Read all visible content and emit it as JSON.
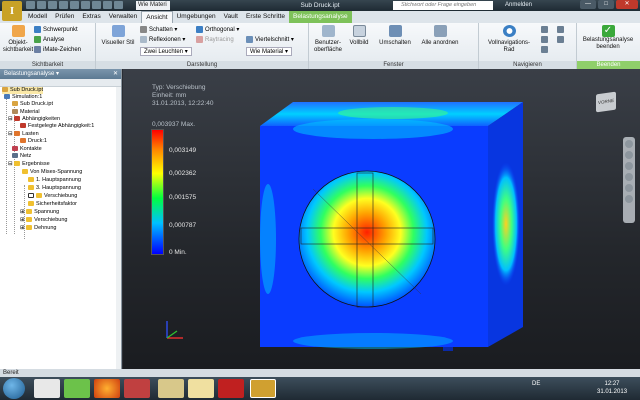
{
  "app": {
    "title": "Sub Druck.ipt",
    "qat_material": "Wie Materi",
    "search_placeholder": "Stichwort oder Frage eingeben",
    "login": "Anmelden",
    "window_controls": [
      "—",
      "□",
      "✕"
    ]
  },
  "tabs": [
    "Modell",
    "Prüfen",
    "Extras",
    "Verwalten",
    "Ansicht",
    "Umgebungen",
    "Vault",
    "Erste Schritte",
    "Belastungsanalyse"
  ],
  "active_tab": "Ansicht",
  "ribbon": {
    "sichtbarkeit": {
      "label": "Sichtbarkeit",
      "objekt": "Objekt-\nsichtbarkeit",
      "schwerpunkt": "Schwerpunkt",
      "analyse": "Analyse",
      "imate": "iMate-Zeichen"
    },
    "darstellung": {
      "label": "Darstellung",
      "visueller_stil": "Visueller Stil",
      "schatten": "Schatten",
      "reflexionen": "Reflexionen",
      "zwei_leuchten": "Zwei Leuchten",
      "orthogonal": "Orthogonal",
      "raytracing": "Raytracing",
      "viertelschnitt": "Viertelschnitt",
      "wie_material": "Wie Material"
    },
    "fenster": {
      "label": "Fenster",
      "benutzer": "Benutzer-\noberfläche",
      "vollbild": "Vollbild",
      "umschalten": "Umschalten",
      "alle_anordnen": "Alle anordnen"
    },
    "navigieren": {
      "label": "Navigieren",
      "vollnav": "Vollnavigations-\nRad"
    },
    "beenden": {
      "label": "Beenden",
      "button": "Belastungsanalyse\nbeenden"
    }
  },
  "browser": {
    "title": "Belastungsanalyse",
    "items": [
      "Sub Druck.ipt",
      "Simulation:1",
      "Sub Druck.ipt",
      "Material",
      "Abhängigkeiten",
      "Festgelegte Abhängigkeit:1",
      "Lasten",
      "Druck:1",
      "Kontakte",
      "Netz",
      "Ergebnisse",
      "Von Mises-Spannung",
      "1. Hauptspannung",
      "3. Hauptspannung",
      "Verschiebung",
      "Sicherheitsfaktor",
      "Spannung",
      "Verschiebung",
      "Dehnung"
    ]
  },
  "legend": {
    "type_line": "Typ: Verschiebung",
    "unit_line": "Einheit: mm",
    "date_line": "31.01.2013, 12:22:40",
    "max": "0,003937 Max.",
    "ticks": [
      "0,003149",
      "0,002362",
      "0,001575",
      "0,000787",
      "0 Min."
    ]
  },
  "viewcube_label": "VORNE",
  "status": "Bereit",
  "taskbar": {
    "lang": "DE",
    "time": "12:27",
    "date": "31.01.2013"
  },
  "colors": {
    "context_tab": "#7ec25a",
    "legend_max": "#ff0000",
    "legend_min": "#0000ff",
    "model_base": "#0a3cff"
  }
}
